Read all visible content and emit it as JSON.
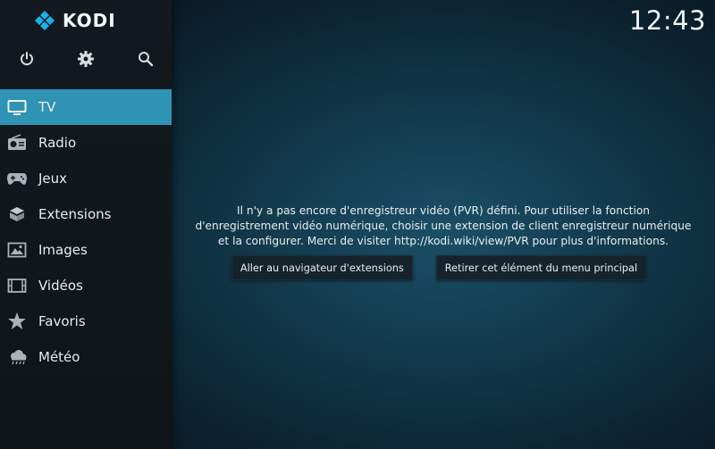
{
  "app": {
    "name": "KODI"
  },
  "clock": "12:43",
  "toolbar": {
    "icons": [
      "power-icon",
      "gear-icon",
      "search-icon"
    ]
  },
  "menu": {
    "items": [
      {
        "label": "TV",
        "icon": "tv-icon",
        "active": true
      },
      {
        "label": "Radio",
        "icon": "radio-icon",
        "active": false
      },
      {
        "label": "Jeux",
        "icon": "gamepad-icon",
        "active": false
      },
      {
        "label": "Extensions",
        "icon": "box-icon",
        "active": false
      },
      {
        "label": "Images",
        "icon": "picture-icon",
        "active": false
      },
      {
        "label": "Vidéos",
        "icon": "film-icon",
        "active": false
      },
      {
        "label": "Favoris",
        "icon": "star-icon",
        "active": false
      },
      {
        "label": "Météo",
        "icon": "weather-icon",
        "active": false
      }
    ]
  },
  "message": {
    "line1": "Il n'y a pas encore d'enregistreur vidéo (PVR) défini. Pour utiliser la fonction",
    "line2": "d'enregistrement vidéo numérique, choisir une extension de client enregistreur numérique",
    "line3": "et la configurer. Merci de visiter http://kodi.wiki/view/PVR pour plus d'informations."
  },
  "actions": {
    "addon_browser": "Aller au navigateur d'extensions",
    "remove_item": "Retirer cet élément du menu principal"
  },
  "colors": {
    "accent": "#2f93b3",
    "sidebar": "#13191e",
    "background": "#123a4d"
  }
}
